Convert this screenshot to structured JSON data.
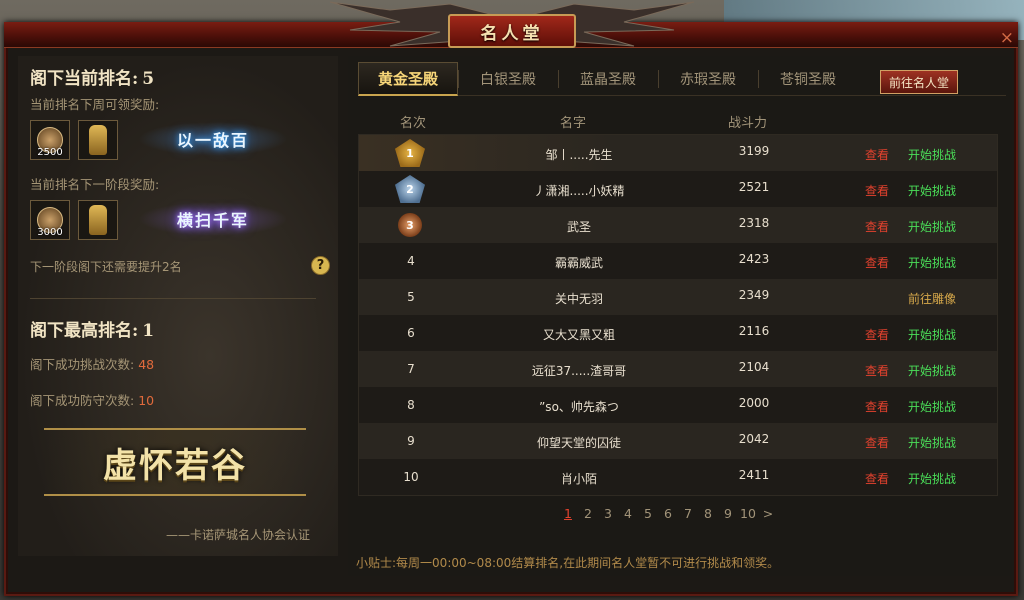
{
  "window": {
    "title": "名人堂",
    "close_icon": "×"
  },
  "left": {
    "current_rank_label": "阁下当前排名:",
    "current_rank_value": "5",
    "weekly_reward_label": "当前排名下周可领奖励:",
    "weekly_reward_items": [
      {
        "icon": "medal-icon",
        "qty": "2500"
      },
      {
        "icon": "armor-icon",
        "qty": ""
      }
    ],
    "weekly_title": "以一敌百",
    "next_reward_label": "当前排名下一阶段奖励:",
    "next_reward_items": [
      {
        "icon": "medal-icon",
        "qty": "3000"
      },
      {
        "icon": "armor-icon",
        "qty": ""
      }
    ],
    "next_title": "横扫千军",
    "next_need_text": "下一阶段阁下还需要提升2名",
    "help_icon": "?",
    "best_rank_label": "阁下最高排名:",
    "best_rank_value": "1",
    "win_challenges_label": "阁下成功挑战次数:",
    "win_challenges_value": "48",
    "win_defense_label": "阁下成功防守次数:",
    "win_defense_value": "10",
    "honor_title": "虚怀若谷",
    "signature": "——卡诺萨城名人协会认证"
  },
  "tabs": [
    "黄金圣殿",
    "白银圣殿",
    "蓝晶圣殿",
    "赤瑕圣殿",
    "苍铜圣殿"
  ],
  "goto_button": "前往名人堂",
  "table": {
    "headers": {
      "rank": "名次",
      "name": "名字",
      "power": "战斗力"
    },
    "rows": [
      {
        "rank": "1",
        "name": "邹丨.....先生",
        "power": "3199",
        "view": "查看",
        "action": "开始挑战"
      },
      {
        "rank": "2",
        "name": "丿潇湘.....小妖精",
        "power": "2521",
        "view": "查看",
        "action": "开始挑战"
      },
      {
        "rank": "3",
        "name": "武圣",
        "power": "2318",
        "view": "查看",
        "action": "开始挑战"
      },
      {
        "rank": "4",
        "name": "霸霸威武",
        "power": "2423",
        "view": "查看",
        "action": "开始挑战"
      },
      {
        "rank": "5",
        "name": "关中无羽",
        "power": "2349",
        "view": "",
        "action": "前往雕像"
      },
      {
        "rank": "6",
        "name": "又大又黑又粗",
        "power": "2116",
        "view": "查看",
        "action": "开始挑战"
      },
      {
        "rank": "7",
        "name": "远征37.....渣哥哥",
        "power": "2104",
        "view": "查看",
        "action": "开始挑战"
      },
      {
        "rank": "8",
        "name": "”so、帅先森つ",
        "power": "2000",
        "view": "查看",
        "action": "开始挑战"
      },
      {
        "rank": "9",
        "name": "仰望天堂的囚徒",
        "power": "2042",
        "view": "查看",
        "action": "开始挑战"
      },
      {
        "rank": "10",
        "name": "肖小陌",
        "power": "2411",
        "view": "查看",
        "action": "开始挑战"
      }
    ]
  },
  "pager": {
    "pages": [
      "1",
      "2",
      "3",
      "4",
      "5",
      "6",
      "7",
      "8",
      "9",
      "10"
    ],
    "current": "1",
    "next": ">"
  },
  "tip": "小贴士:每周一00:00~08:00结算排名,在此期间名人堂暂不可进行挑战和领奖。"
}
